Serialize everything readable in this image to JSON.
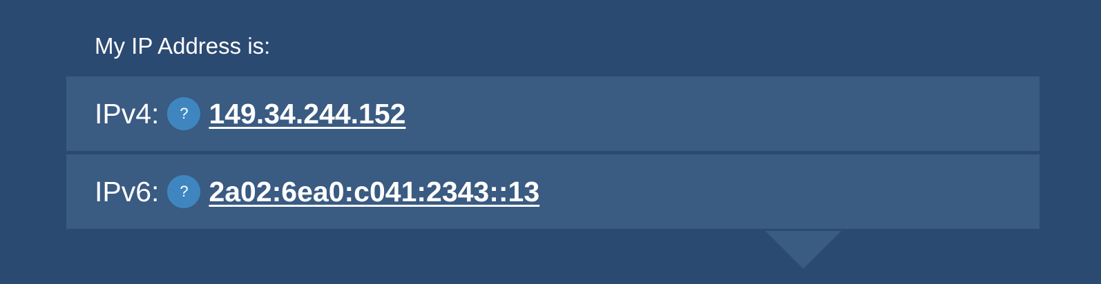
{
  "heading": "My IP Address is:",
  "rows": [
    {
      "label": "IPv4:",
      "help_icon": "?",
      "value": "149.34.244.152"
    },
    {
      "label": "IPv6:",
      "help_icon": "?",
      "value": "2a02:6ea0:c041:2343::13"
    }
  ],
  "colors": {
    "background": "#2b4a72",
    "panel": "#3a5b82",
    "help_icon": "#3f86c0",
    "text": "#ffffff"
  }
}
